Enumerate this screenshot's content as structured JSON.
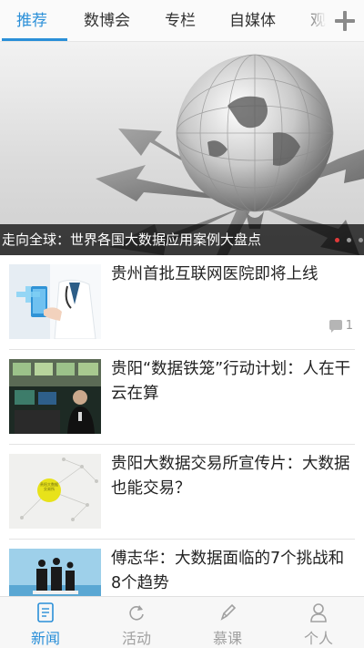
{
  "tabs": [
    {
      "label": "推荐",
      "active": true
    },
    {
      "label": "数博会",
      "active": false
    },
    {
      "label": "专栏",
      "active": false
    },
    {
      "label": "自媒体",
      "active": false
    },
    {
      "label": "观",
      "active": false
    }
  ],
  "add_icon": "plus-icon",
  "banner": {
    "title": "走向全球：世界各国大数据应用案例大盘点",
    "slide_count": 3,
    "active_slide": 1
  },
  "articles": [
    {
      "title": "贵州首批互联网医院即将上线",
      "comments": "1",
      "thumb": "doctor-tablet"
    },
    {
      "title": "贵阳“数据铁笼”行动计划：人在干 云在算",
      "comments": "",
      "thumb": "control-room"
    },
    {
      "title": "贵阳大数据交易所宣传片：大数据也能交易？",
      "comments": "",
      "thumb": "yellow-circle-network",
      "thumb_text": "贵阳大数据交易所"
    },
    {
      "title": "傅志华：大数据面临的7个挑战和8个趋势",
      "comments": "",
      "thumb": "businessmen-silhouettes"
    }
  ],
  "bottom_nav": [
    {
      "label": "新闻",
      "icon": "news-icon",
      "active": true
    },
    {
      "label": "活动",
      "icon": "refresh-icon",
      "active": false
    },
    {
      "label": "慕课",
      "icon": "pencil-icon",
      "active": false
    },
    {
      "label": "个人",
      "icon": "person-icon",
      "active": false
    }
  ],
  "colors": {
    "accent": "#2a8fd8",
    "inactive": "#a0a0a0",
    "dot_active": "#e03a3a"
  }
}
